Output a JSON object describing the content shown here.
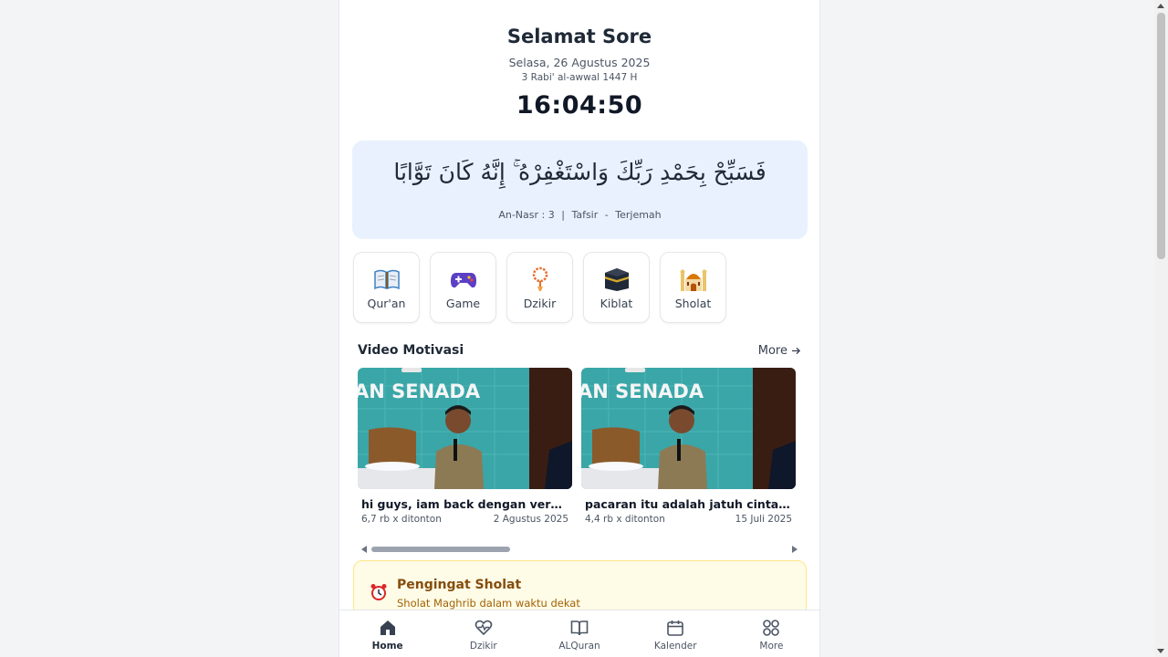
{
  "header": {
    "greeting": "Selamat Sore",
    "date": "Selasa, 26 Agustus 2025",
    "hijri_date": "3 Rabi' al-awwal 1447 H",
    "clock": "16:04:50"
  },
  "verse": {
    "arabic": "فَسَبِّحْ بِحَمْدِ رَبِّكَ وَاسْتَغْفِرْهُ ۚ إِنَّهُ كَانَ تَوَّابًا",
    "reference": "An-Nasr : 3",
    "separator": "|",
    "tafsir_label": "Tafsir",
    "dash": "-",
    "translation_label": "Terjemah"
  },
  "menu": {
    "items": [
      {
        "label": "Qur'an",
        "icon": "open-book-icon"
      },
      {
        "label": "Game",
        "icon": "game-controller-icon"
      },
      {
        "label": "Dzikir",
        "icon": "prayer-beads-icon"
      },
      {
        "label": "Kiblat",
        "icon": "kaaba-icon"
      },
      {
        "label": "Sholat",
        "icon": "mosque-icon"
      }
    ]
  },
  "videos": {
    "section_title": "Video Motivasi",
    "more_label": "More",
    "items": [
      {
        "title": "hi guys, iam back dengan versi...",
        "views": "6,7 rb x ditonton",
        "date": "2 Agustus 2025",
        "banner_text": "AN SENADA"
      },
      {
        "title": "pacaran itu adalah jatuh cinta paling...",
        "views": "4,4 rb x ditonton",
        "date": "15 Juli 2025",
        "banner_text": "AN SENADA"
      }
    ]
  },
  "reminder": {
    "title": "Pengingat Sholat",
    "text": "Sholat Maghrib dalam waktu dekat",
    "icon": "alarm-clock-icon"
  },
  "bottom_nav": {
    "items": [
      {
        "label": "Home",
        "icon": "home-icon",
        "active": true
      },
      {
        "label": "Dzikir",
        "icon": "heart-pulse-icon",
        "active": false
      },
      {
        "label": "ALQuran",
        "icon": "book-icon",
        "active": false
      },
      {
        "label": "Kalender",
        "icon": "calendar-icon",
        "active": false
      },
      {
        "label": "More",
        "icon": "grid-icon",
        "active": false
      }
    ]
  },
  "colors": {
    "verse_card_bg": "#e8f1fd",
    "reminder_bg": "#fefbe6",
    "reminder_title": "#854d0e",
    "video_bg_teal": "#3aa6a8"
  }
}
